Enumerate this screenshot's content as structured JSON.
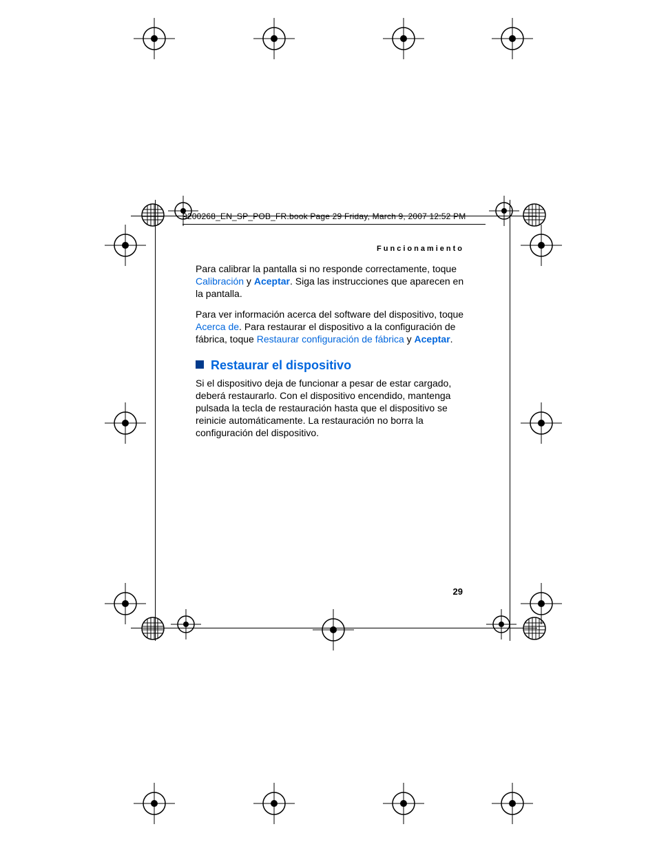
{
  "header": {
    "book_line": "9200268_EN_SP_POB_FR.book  Page 29  Friday, March 9, 2007  12:52 PM"
  },
  "running_head": "Funcionamiento",
  "para1": {
    "t1": "Para calibrar la pantalla si no responde correctamente, toque ",
    "link1": "Calibración",
    "t2": " y ",
    "link2": "Aceptar",
    "t3": ". Siga las instrucciones que aparecen en la pantalla."
  },
  "para2": {
    "t1": "Para ver información acerca del software del dispositivo, toque ",
    "link1": "Acerca de",
    "t2": ". Para restaurar el dispositivo a la configuración de fábrica, toque ",
    "link2": "Restaurar configuración de fábrica",
    "t3": " y ",
    "link3": "Aceptar",
    "t4": "."
  },
  "heading": "Restaurar el dispositivo",
  "para3": "Si el dispositivo deja de funcionar a pesar de estar cargado, deberá restaurarlo. Con el dispositivo encendido, mantenga pulsada la tecla de restauración hasta que el dispositivo se reinicie automáticamente. La restauración no borra la configuración del dispositivo.",
  "page_number": "29"
}
